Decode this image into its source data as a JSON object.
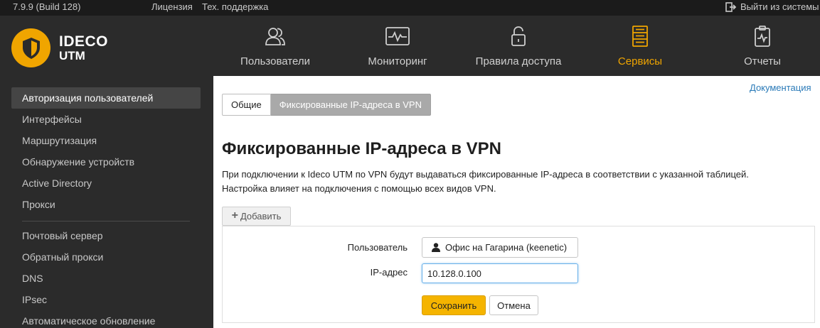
{
  "topbar": {
    "version": "7.9.9 (Build 128)",
    "license_link": "Лицензия",
    "support_link": "Тех. поддержка",
    "logout_label": "Выйти из системы"
  },
  "brand": {
    "name": "IDECO",
    "product": "UTM",
    "accent_color": "#f0a500"
  },
  "nav": {
    "items": [
      {
        "label": "Пользователи",
        "icon": "users-icon"
      },
      {
        "label": "Мониторинг",
        "icon": "monitoring-icon"
      },
      {
        "label": "Правила доступа",
        "icon": "lock-icon"
      },
      {
        "label": "Сервисы",
        "icon": "server-icon",
        "active": true
      },
      {
        "label": "Отчеты",
        "icon": "report-icon"
      }
    ]
  },
  "sidebar": {
    "items": [
      {
        "label": "Авторизация пользователей",
        "active": true
      },
      {
        "label": "Интерфейсы"
      },
      {
        "label": "Маршрутизация"
      },
      {
        "label": "Обнаружение устройств"
      },
      {
        "label": "Active Directory"
      },
      {
        "label": "Прокси"
      },
      {
        "label": "Почтовый сервер"
      },
      {
        "label": "Обратный прокси"
      },
      {
        "label": "DNS"
      },
      {
        "label": "IPsec"
      },
      {
        "label": "Автоматическое обновление"
      }
    ]
  },
  "main": {
    "doc_link": "Документация",
    "tabs": [
      {
        "label": "Общие"
      },
      {
        "label": "Фиксированные IP-адреса в VPN",
        "active": true
      }
    ],
    "title": "Фиксированные IP-адреса в VPN",
    "description_line1": "При подключении к Ideco UTM по VPN будут выдаваться фиксированные IP-адреса в соответствии с указанной таблицей.",
    "description_line2": "Настройка влияет на подключения с помощью всех видов VPN.",
    "add_button": "Добавить",
    "form": {
      "user_label": "Пользователь",
      "user_value": "Офис на Гагарина (keenetic)",
      "ip_label": "IP-адрес",
      "ip_value": "10.128.0.100",
      "save_button": "Сохранить",
      "cancel_button": "Отмена"
    }
  }
}
